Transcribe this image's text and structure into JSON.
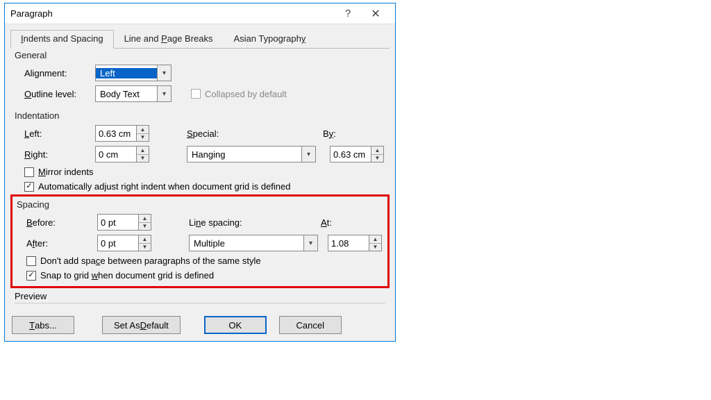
{
  "title": "Paragraph",
  "tabs": {
    "indents": "Indents and Spacing",
    "line": "Line and Page Breaks",
    "asian": "Asian Typography"
  },
  "general": {
    "label": "General",
    "alignment_label": "Alignment:",
    "alignment_value": "Left",
    "outline_label": "Outline level:",
    "outline_value": "Body Text",
    "collapsed": "Collapsed by default"
  },
  "indentation": {
    "label": "Indentation",
    "left_label": "Left:",
    "left_value": "0.63 cm",
    "right_label": "Right:",
    "right_value": "0 cm",
    "special_label": "Special:",
    "special_value": "Hanging",
    "by_label": "By:",
    "by_value": "0.63 cm",
    "mirror": "Mirror indents",
    "auto_adjust": "Automatically adjust right indent when document grid is defined"
  },
  "spacing": {
    "label": "Spacing",
    "before_label": "Before:",
    "before_value": "0 pt",
    "after_label": "After:",
    "after_value": "0 pt",
    "line_label": "Line spacing:",
    "line_value": "Multiple",
    "at_label": "At:",
    "at_value": "1.08",
    "dont_add": "Don't add space between paragraphs of the same style",
    "snap": "Snap to grid when document grid is defined"
  },
  "preview_label": "Preview",
  "footer": {
    "tabs": "Tabs...",
    "default": "Set As Default",
    "ok": "OK",
    "cancel": "Cancel"
  }
}
